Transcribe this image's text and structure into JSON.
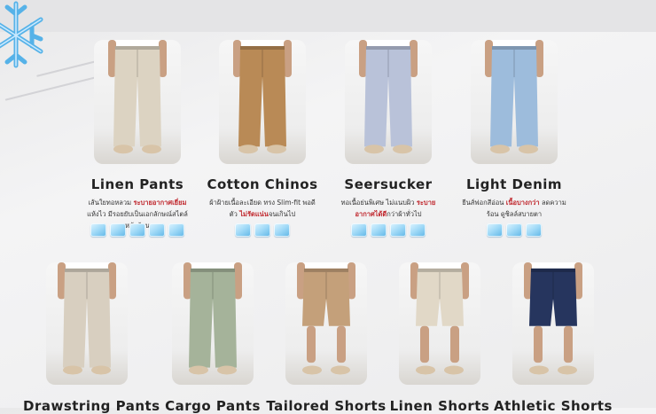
{
  "row1": [
    {
      "name": "Linen Pants",
      "desc_a": "เส้นใยทอหลวม ",
      "desc_hl": "ระบายอากาศเยี่ยม",
      "desc_b": " แห้งไว มีรอยยับเป็นเอกลักษณ์สไตล์หน้าร้อน",
      "rating": 5,
      "color": "#dcd3c2"
    },
    {
      "name": "Cotton Chinos",
      "desc_a": "ผ้าฝ้ายเนื้อละเอียด ทรง Slim-fit พอดีตัว ",
      "desc_hl": "ไม่รัดแน่น",
      "desc_b": "จนเกินไป",
      "rating": 3,
      "color": "#b98a56"
    },
    {
      "name": "Seersucker",
      "desc_a": "ทอเนื้อย่นพิเศษ ไม่แนบผิว ",
      "desc_hl": "ระบายอากาศได้ดี",
      "desc_b": "กว่าผ้าทั่วไป",
      "rating": 4,
      "color": "#b9c2d9"
    },
    {
      "name": "Light Denim",
      "desc_a": "ยีนส์ฟอกสีอ่อน ",
      "desc_hl": "เนื้อบางกว่า",
      "desc_b": " ลดความร้อน ดูชิลล์สบายตา",
      "rating": 3,
      "color": "#9dbcdc"
    }
  ],
  "row2": [
    {
      "name": "Drawstring Pants",
      "color": "#d8cfc0"
    },
    {
      "name": "Cargo Pants",
      "color": "#a5b39a"
    },
    {
      "name": "Tailored Shorts",
      "color": "#c4a07a"
    },
    {
      "name": "Linen Shorts",
      "color": "#e1d8c7"
    },
    {
      "name": "Athletic Shorts",
      "color": "#26355e"
    }
  ],
  "accent_color": "#c0282e",
  "icons": {
    "corner": "snowflake-icon",
    "rating": "ice-cube-icon"
  }
}
